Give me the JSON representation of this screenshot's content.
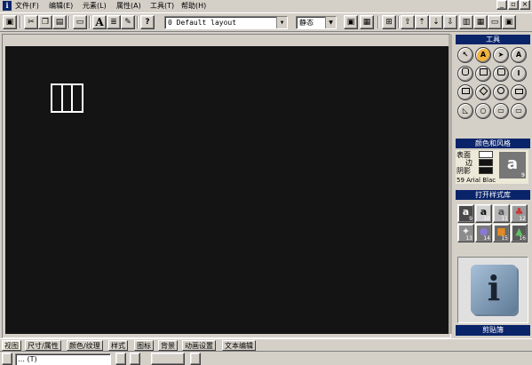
{
  "menubar": {
    "app_icon": "i",
    "items": [
      {
        "label": "文件(F)"
      },
      {
        "label": "编辑(E)"
      },
      {
        "label": "元素(L)"
      },
      {
        "label": "属性(A)"
      },
      {
        "label": "工具(T)"
      },
      {
        "label": "帮助(H)"
      }
    ]
  },
  "toolbar": {
    "layout_combo": "0 Default layout",
    "state_combo": "静态",
    "text_glyph": "A",
    "help_glyph": "?"
  },
  "panel": {
    "tools_title": "工具",
    "tool_glyphs": [
      "↖",
      "A",
      "➤",
      "A",
      "",
      "",
      "",
      "I",
      "",
      "",
      "",
      "",
      "◺",
      "○",
      "▭",
      "▭"
    ],
    "color_style_title": "颜色和风格",
    "surface_label": "表面",
    "edge_label": "边",
    "shadow_label": "阴影",
    "preview_letter": "a",
    "preview_number": "9",
    "font_line": "59 Arial Blac",
    "style_lib_title": "打开样式库",
    "styles": [
      {
        "glyph": "a",
        "num": "9",
        "bg": "#4a4a4a",
        "fg": "#ffffff"
      },
      {
        "glyph": "a",
        "num": "10",
        "bg": "#d0d0d0",
        "fg": "#111111"
      },
      {
        "glyph": "a",
        "num": "11",
        "bg": "#b8b8b8",
        "fg": "#555555"
      },
      {
        "glyph": "♣",
        "num": "12",
        "bg": "#9a9a9a",
        "fg": "#d03030"
      },
      {
        "glyph": "✦",
        "num": "13",
        "bg": "#8c8c8c",
        "fg": "#f0f0f0"
      },
      {
        "glyph": "●",
        "num": "14",
        "bg": "#7a7a7a",
        "fg": "#8a78d8"
      },
      {
        "glyph": "■",
        "num": "15",
        "bg": "#6a6a6a",
        "fg": "#e08a20"
      },
      {
        "glyph": "▲",
        "num": "16",
        "bg": "#5a5a5a",
        "fg": "#60c060"
      }
    ],
    "clipboard_label": "剪贴簿"
  },
  "tabs": [
    {
      "label": "视图"
    },
    {
      "label": "尺寸/属性"
    },
    {
      "label": "颜色/纹理"
    },
    {
      "label": "样式"
    },
    {
      "label": "图标"
    },
    {
      "label": "背景"
    },
    {
      "label": "动画设置"
    },
    {
      "label": "文本编辑"
    }
  ],
  "bottom": {
    "font_box": "… (T)"
  },
  "colors": {
    "accent": "#0a246a",
    "stage": "#141414",
    "active_tool": "#f2b33d"
  }
}
